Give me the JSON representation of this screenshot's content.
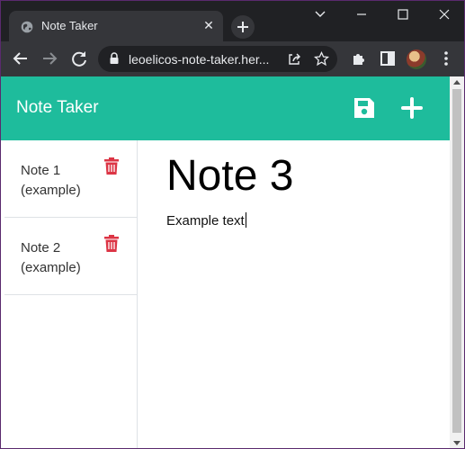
{
  "browser": {
    "tab_title": "Note Taker",
    "tab_close": "✕",
    "url": "leoelicos-note-taker.her...",
    "colors": {
      "frame": "#202124",
      "toolbar": "#35363a",
      "window_border": "#5a2a6e"
    },
    "icons": [
      "globe-icon",
      "close-icon",
      "plus-icon",
      "chevron-down-icon",
      "minimize-icon",
      "maximize-icon",
      "window-close-icon",
      "back-icon",
      "forward-icon",
      "reload-icon",
      "lock-icon",
      "share-icon",
      "star-icon",
      "extensions-icon",
      "side-panel-icon",
      "avatar",
      "menu-kebab-icon"
    ]
  },
  "app": {
    "brand": "Note Taker",
    "colors": {
      "navbar": "#1ebc9c",
      "trash": "#dc3545"
    },
    "notes": [
      {
        "title": "Note 1 (example)"
      },
      {
        "title": "Note 2 (example)"
      }
    ],
    "active_note": {
      "title": "Note 3",
      "text": "Example text"
    }
  }
}
